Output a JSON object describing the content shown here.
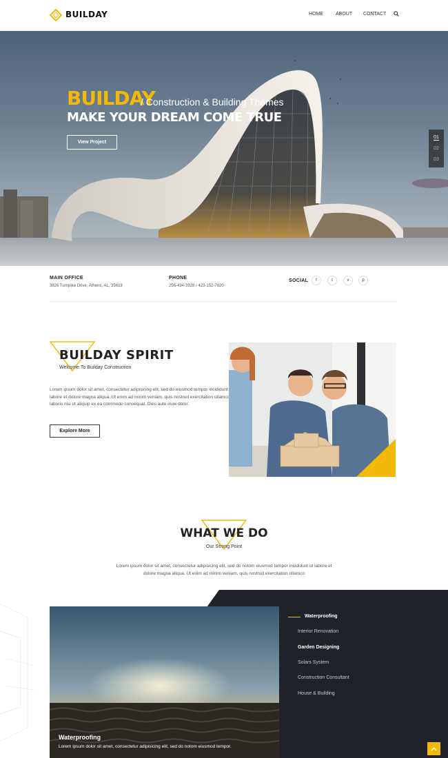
{
  "brand": {
    "name": "BUILDAY",
    "accent_color": "#f2b90b",
    "dark_color": "#1f2228"
  },
  "nav": {
    "home": "HOME",
    "about": "ABOUT",
    "contact": "CONTACT",
    "search_icon": "search-icon"
  },
  "hero": {
    "brand": "BUILDAY",
    "subtitle": "/ Construction & Building Themes",
    "title": "MAKE YOUR DREAM COME TRUE",
    "button": "View Project",
    "slides": [
      "01",
      "02",
      "03"
    ],
    "active_slide": "01"
  },
  "info": {
    "office_title": "MAIN OFFICE",
    "office_text": "3826 Turnpike Drive, Athens, AL, 35613",
    "phone_title": "PHONE",
    "phone_text": "256-434-3328 / 423-152-7820",
    "social_title": "SOCIAL",
    "social_icons": [
      "f",
      "t",
      "v",
      "p"
    ]
  },
  "spirit": {
    "title": "BUILDAY SPIRIT",
    "subtitle": "Welcome To Builday Construction",
    "body": "Lorem ipsum dolor sit amet, consectetur adipisicing elit, sed do eiusmod tempor incididunt ut labore et dolore magna aliqua. Ut enim ad minim veniam, quis nostrud exercitation ullamco laboris nisi ut aliquip ex ea commodo consequat. Duis aute irure dolor.",
    "button": "Explore More"
  },
  "whatwedo": {
    "title": "WHAT WE DO",
    "subtitle": "Our Strong Point",
    "body": "Lorem ipsum dolor sit amet, consectetur adipisicing elit, sed do notom eiusmod tempor incididunt ut labore et dolore magna aliqua. Ut enim ad minim veniam, quis nostrud exercitation ullamco"
  },
  "services": {
    "items": [
      "Waterproofing",
      "Interior Renovation",
      "Garden Designing",
      "Solars System",
      "Construction Consultant",
      "House & Building"
    ],
    "active": "Waterproofing",
    "caption_title": "Waterproofing",
    "caption_text": "Lorem ipsum dolor sit amet, consectetur adipisicing elit, sed do notom eiusmod tempor."
  }
}
